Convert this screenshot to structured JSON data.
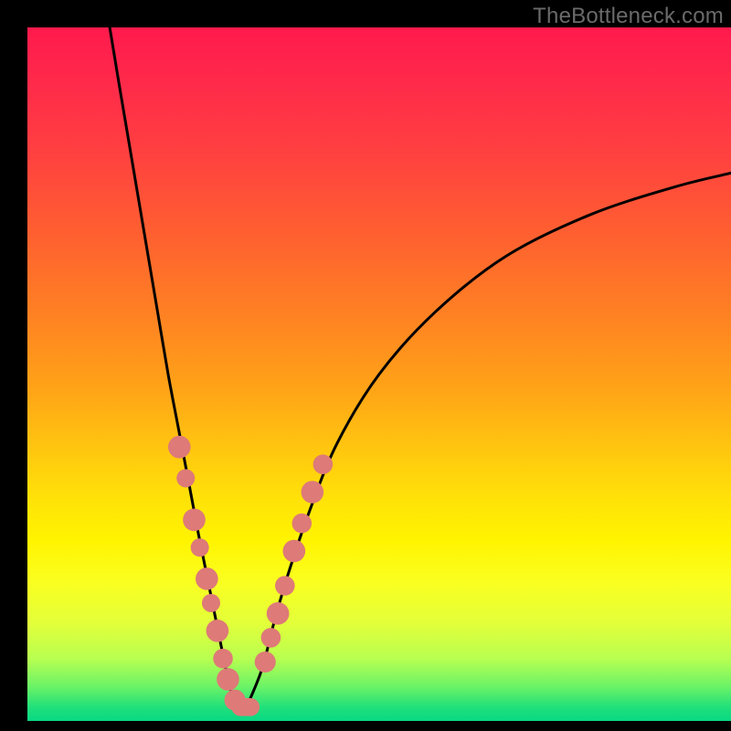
{
  "watermark": "TheBottleneck.com",
  "colors": {
    "frame": "#000000",
    "curve": "#000000",
    "marker": "#de7a78",
    "gradient_top": "#ff1a4d",
    "gradient_bottom": "#08d884"
  },
  "chart_data": {
    "type": "line",
    "title": "",
    "xlabel": "",
    "ylabel": "",
    "xlim": [
      0,
      100
    ],
    "ylim": [
      0,
      100
    ],
    "series": [
      {
        "name": "left_branch",
        "x": [
          11.7,
          13.0,
          15.0,
          17.0,
          18.5,
          20.0,
          21.5,
          23.0,
          24.3,
          25.5,
          26.5,
          27.5,
          28.3,
          29.0,
          29.5,
          30.0
        ],
        "y": [
          100.0,
          92.0,
          80.0,
          68.0,
          59.0,
          50.0,
          42.0,
          34.0,
          27.0,
          21.0,
          16.0,
          11.0,
          7.0,
          4.0,
          2.0,
          1.0
        ]
      },
      {
        "name": "right_branch",
        "x": [
          30.0,
          31.0,
          32.0,
          33.5,
          35.0,
          37.0,
          40.0,
          44.0,
          50.0,
          58.0,
          68.0,
          80.0,
          92.0,
          100.0
        ],
        "y": [
          1.0,
          2.0,
          4.0,
          8.0,
          14.0,
          21.0,
          30.0,
          40.0,
          50.0,
          59.0,
          67.0,
          73.0,
          77.0,
          79.0
        ]
      }
    ],
    "markers": [
      {
        "x": 21.6,
        "y": 39.5,
        "r": 1.6
      },
      {
        "x": 22.5,
        "y": 35.0,
        "r": 1.3
      },
      {
        "x": 23.7,
        "y": 29.0,
        "r": 1.6
      },
      {
        "x": 24.5,
        "y": 25.0,
        "r": 1.3
      },
      {
        "x": 25.5,
        "y": 20.5,
        "r": 1.6
      },
      {
        "x": 26.1,
        "y": 17.0,
        "r": 1.3
      },
      {
        "x": 27.0,
        "y": 13.0,
        "r": 1.6
      },
      {
        "x": 27.8,
        "y": 9.0,
        "r": 1.4
      },
      {
        "x": 28.5,
        "y": 6.0,
        "r": 1.6
      },
      {
        "x": 29.5,
        "y": 3.0,
        "r": 1.5
      },
      {
        "x": 33.8,
        "y": 8.5,
        "r": 1.5
      },
      {
        "x": 34.6,
        "y": 12.0,
        "r": 1.4
      },
      {
        "x": 35.6,
        "y": 15.5,
        "r": 1.6
      },
      {
        "x": 36.6,
        "y": 19.5,
        "r": 1.4
      },
      {
        "x": 37.9,
        "y": 24.5,
        "r": 1.6
      },
      {
        "x": 39.0,
        "y": 28.5,
        "r": 1.4
      },
      {
        "x": 40.5,
        "y": 33.0,
        "r": 1.6
      },
      {
        "x": 42.0,
        "y": 37.0,
        "r": 1.4
      }
    ],
    "bottom_capsule": {
      "x0": 29.0,
      "x1": 33.0,
      "y": 2.0,
      "thickness": 2.6
    }
  }
}
